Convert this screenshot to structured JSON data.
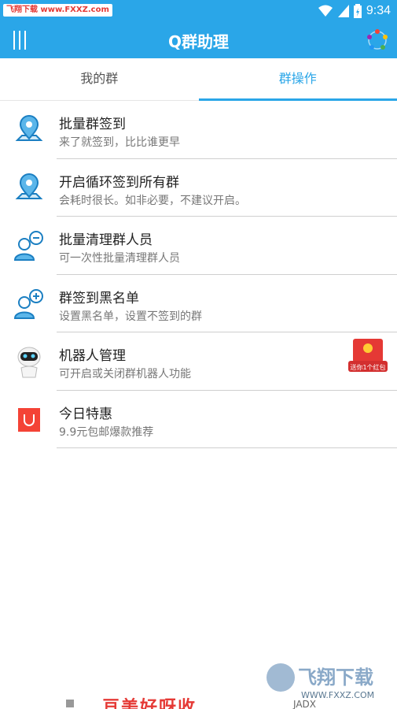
{
  "status_bar": {
    "watermark": "飞翔下载 www.FXXZ.com",
    "time": "9:34"
  },
  "app_bar": {
    "title": "Q群助理",
    "menu_icon": "menu-icon",
    "refresh_icon": "loading-spinner-icon"
  },
  "tabs": [
    {
      "label": "我的群",
      "active": false
    },
    {
      "label": "群操作",
      "active": true
    }
  ],
  "list": [
    {
      "title": "批量群签到",
      "subtitle": "来了就签到，比比谁更早",
      "icon": "map-pin-icon"
    },
    {
      "title": "开启循环签到所有群",
      "subtitle": "会耗时很长。如非必要，不建议开启。",
      "icon": "map-pin-icon"
    },
    {
      "title": "批量清理群人员",
      "subtitle": "可一次性批量清理群人员",
      "icon": "user-minus-icon"
    },
    {
      "title": "群签到黑名单",
      "subtitle": "设置黑名单，设置不签到的群",
      "icon": "user-plus-icon"
    },
    {
      "title": "机器人管理",
      "subtitle": "可开启或关闭群机器人功能",
      "icon": "robot-icon",
      "badge": "送你1个红包"
    },
    {
      "title": "今日特惠",
      "subtitle": "9.9元包邮爆款推荐",
      "icon": "shopping-bag-icon"
    }
  ],
  "ad": {
    "text": "亘美好呀收",
    "watermark_site": "WWW.FXXZ.COM",
    "watermark_brand": "飞翔下载",
    "watermark_sub": "JADX"
  },
  "colors": {
    "primary": "#2aa6e8",
    "text": "#222222",
    "subtext": "#777777",
    "accent_red": "#e53935"
  }
}
